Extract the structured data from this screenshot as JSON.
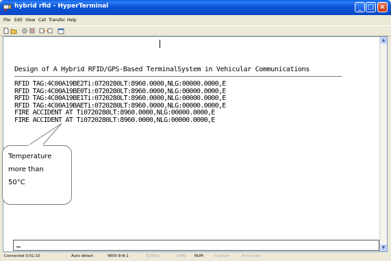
{
  "window": {
    "title": "hybrid rfid - HyperTerminal",
    "controls": {
      "minimize": "_",
      "maximize": "□",
      "close": "×"
    }
  },
  "menu": [
    "File",
    "Edit",
    "View",
    "Call",
    "Transfer",
    "Help"
  ],
  "toolbar_icons": [
    "new-icon",
    "open-icon",
    "disconnect-icon",
    "dial-icon",
    "send-icon",
    "receive-icon",
    "properties-icon"
  ],
  "terminal": {
    "heading": "Design of A Hybrid RFID/GPS-Based TerminalSystem in Vehicular Communications",
    "lines": [
      "RFID TAG:4C00A19BE2Ti:0720280LT:8960.0000,NLG:00000.0000,E",
      "RFID TAG:4C00A19BE0Ti:0720280LT:8960.0000,NLG:00000.0000,E",
      "RFID TAG:4C00A19BE1Ti:0720280LT:8960.0000,NLG:00000.0000,E",
      "RFID TAG:4C00A19BAETi:0720280LT:8960.0000,NLG:00000.0000,E",
      "FIRE ACCIDENT AT Ti0720280LT:8960.0000,NLG:00000.0000,E",
      "FIRE ACCIDENT AT Ti0720280LT:8960.0000,NLG:00000.0000,E"
    ]
  },
  "callout": {
    "lines": [
      "Temperature",
      "more than",
      "50°C"
    ]
  },
  "statusbar": {
    "connected": "Connected 0:01:10",
    "detect": "Auto detect",
    "settings": "9600 8-N-1",
    "scroll": "SCROLL",
    "caps": "CAPS",
    "num": "NUM",
    "capture": "Capture",
    "print_echo": "Print echo"
  }
}
